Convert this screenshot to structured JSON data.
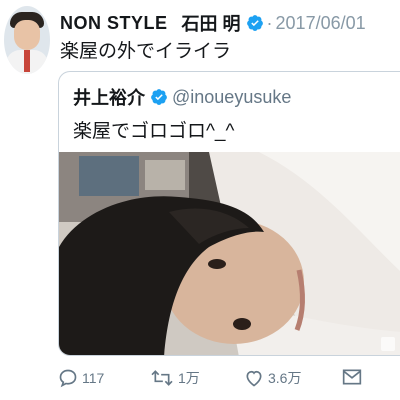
{
  "author": {
    "display_name": "NON STYLE",
    "display_name_2": "石田 明",
    "verified": true,
    "date": "2017/06/01"
  },
  "tweet": {
    "text": "楽屋の外でイライラ"
  },
  "quoted_tweet": {
    "name": "井上裕介",
    "verified": true,
    "handle": "@inoueyusuke",
    "text": "楽屋でゴロゴロ^_^"
  },
  "actions": {
    "reply_count": "117",
    "retweet_count": "1万",
    "like_count": "3.6万"
  },
  "colors": {
    "verified_blue": "#1da1f2",
    "meta_gray": "#657786",
    "card_border": "#c9d3dc"
  },
  "icons": {
    "reply": "reply-icon",
    "retweet": "retweet-icon",
    "like": "heart-icon",
    "message": "envelope-icon",
    "verified": "verified-badge-icon"
  }
}
